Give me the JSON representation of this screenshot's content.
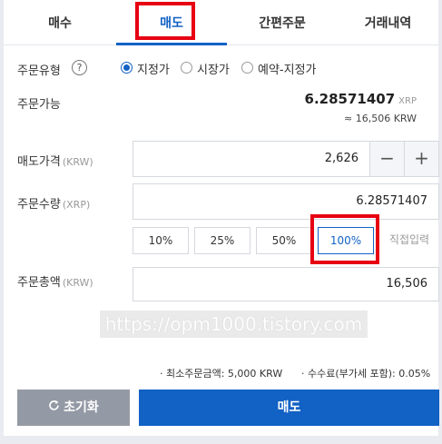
{
  "tabs": [
    {
      "label": "매수"
    },
    {
      "label": "매도"
    },
    {
      "label": "간편주문"
    },
    {
      "label": "거래내역"
    }
  ],
  "active_tab": "매도",
  "accent_color": "#1261c4",
  "highlight_color": "#e60012",
  "order_type": {
    "label": "주문유형",
    "help": "?",
    "options": [
      "지정가",
      "시장가",
      "예약-지정가"
    ],
    "selected": "지정가"
  },
  "available": {
    "label": "주문가능",
    "amount": "6.28571407",
    "unit": "XRP",
    "krw_equiv": "≈ 16,506 KRW"
  },
  "price": {
    "label": "매도가격",
    "unit": "(KRW)",
    "value": "2,626",
    "minus": "−",
    "plus": "+"
  },
  "quantity": {
    "label": "주문수량",
    "unit": "(XRP)",
    "value": "6.28571407"
  },
  "percent_buttons": [
    "10%",
    "25%",
    "50%",
    "100%"
  ],
  "selected_percent": "100%",
  "direct_input": "직접입력",
  "total": {
    "label": "주문총액",
    "unit": "(KRW)",
    "value": "16,506"
  },
  "watermark": "https://opm1000.tistory.com",
  "info": {
    "min_order": "· 최소주문금액: 5,000 KRW",
    "fee": "· 수수료(부가세 포함): 0.05%"
  },
  "buttons": {
    "reset_icon": "refresh-icon",
    "reset": "초기화",
    "submit": "매도"
  }
}
